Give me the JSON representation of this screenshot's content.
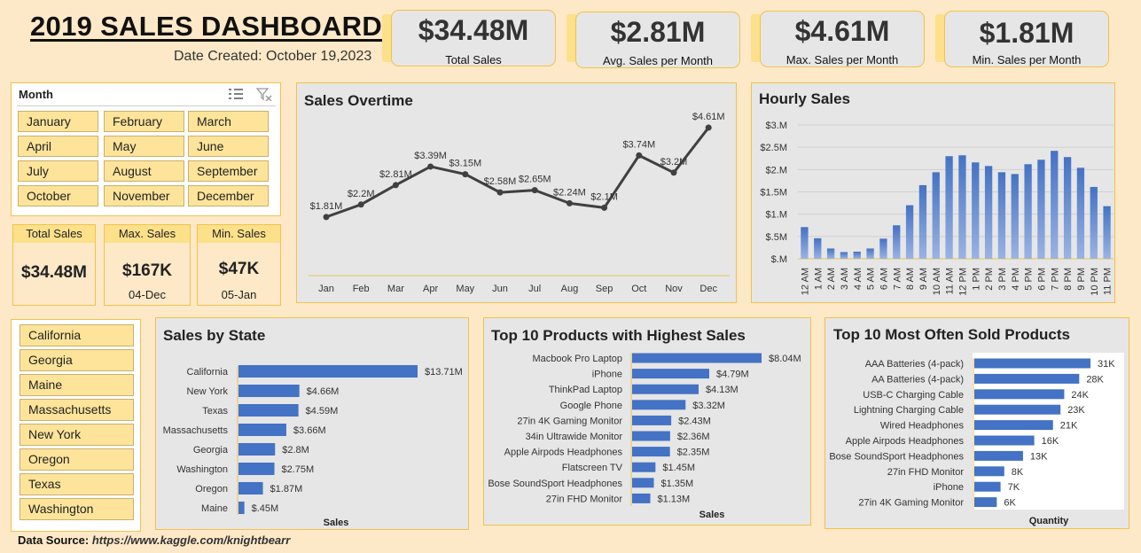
{
  "header": {
    "title": "2019 SALES DASHBOARD",
    "date_created": "Date Created: October 19,2023"
  },
  "kpis": [
    {
      "value": "$34.48M",
      "label": "Total Sales"
    },
    {
      "value": "$2.81M",
      "label": "Avg. Sales per Month"
    },
    {
      "value": "$4.61M",
      "label": "Max. Sales per Month"
    },
    {
      "value": "$1.81M",
      "label": "Min. Sales per Month"
    }
  ],
  "month_slicer": {
    "title": "Month",
    "items": [
      "January",
      "February",
      "March",
      "April",
      "May",
      "June",
      "July",
      "August",
      "September",
      "October",
      "November",
      "December"
    ]
  },
  "mini_cards": [
    {
      "label": "Total Sales",
      "value": "$34.48M",
      "sub": ""
    },
    {
      "label": "Max. Sales",
      "value": "$167K",
      "sub": "04-Dec"
    },
    {
      "label": "Min. Sales",
      "value": "$47K",
      "sub": "05-Jan"
    }
  ],
  "state_slicer": {
    "items": [
      "California",
      "Georgia",
      "Maine",
      "Massachusetts",
      "New York",
      "Oregon",
      "Texas",
      "Washington"
    ]
  },
  "colors": {
    "bar": "#4472c4",
    "line": "#404040",
    "accent": "#f2c24a",
    "slicer": "#fde49a"
  },
  "footer": {
    "label": "Data Source:",
    "url": "https://www.kaggle.com/knightbearr"
  },
  "chart_data": [
    {
      "id": "sales_overtime",
      "type": "line",
      "title": "Sales Overtime",
      "categories": [
        "Jan",
        "Feb",
        "Mar",
        "Apr",
        "May",
        "Jun",
        "Jul",
        "Aug",
        "Sep",
        "Oct",
        "Nov",
        "Dec"
      ],
      "values": [
        1.81,
        2.2,
        2.81,
        3.39,
        3.15,
        2.58,
        2.65,
        2.24,
        2.1,
        3.74,
        3.2,
        4.61
      ],
      "data_labels": [
        "$1.81M",
        "$2.2M",
        "$2.81M",
        "$3.39M",
        "$3.15M",
        "$2.58M",
        "$2.65M",
        "$2.24M",
        "$2.1M",
        "$3.74M",
        "$3.2M",
        "$4.61M"
      ],
      "ylim": [
        0,
        5
      ],
      "grid": false,
      "xlabel": "",
      "ylabel": ""
    },
    {
      "id": "hourly_sales",
      "type": "bar",
      "title": "Hourly Sales",
      "categories": [
        "12 AM",
        "1 AM",
        "2 AM",
        "3 AM",
        "4 AM",
        "5 AM",
        "6 AM",
        "7 AM",
        "8 AM",
        "9 AM",
        "10 AM",
        "11 AM",
        "12 PM",
        "1 PM",
        "2 PM",
        "3 PM",
        "4 PM",
        "5 PM",
        "6 PM",
        "7 PM",
        "8 PM",
        "9 PM",
        "10 PM",
        "11 PM"
      ],
      "values": [
        0.71,
        0.46,
        0.23,
        0.15,
        0.16,
        0.23,
        0.45,
        0.75,
        1.2,
        1.65,
        1.94,
        2.3,
        2.32,
        2.16,
        2.08,
        1.94,
        1.9,
        2.12,
        2.22,
        2.42,
        2.28,
        2.04,
        1.61,
        1.18
      ],
      "yticks": [
        "$.M",
        "$.5M",
        "$1.M",
        "$1.5M",
        "$2.M",
        "$2.5M",
        "$3.M"
      ],
      "ylim": [
        0,
        3
      ],
      "grid": true,
      "xlabel": "",
      "ylabel": ""
    },
    {
      "id": "sales_by_state",
      "type": "bar",
      "orientation": "horizontal",
      "title": "Sales by State",
      "categories": [
        "California",
        "New York",
        "Texas",
        "Massachusetts",
        "Georgia",
        "Washington",
        "Oregon",
        "Maine"
      ],
      "values": [
        13.71,
        4.66,
        4.59,
        3.66,
        2.8,
        2.75,
        1.87,
        0.45
      ],
      "data_labels": [
        "$13.71M",
        "$4.66M",
        "$4.59M",
        "$3.66M",
        "$2.8M",
        "$2.75M",
        "$1.87M",
        "$.45M"
      ],
      "xlabel": "Sales",
      "ylabel": ""
    },
    {
      "id": "top_products_sales",
      "type": "bar",
      "orientation": "horizontal",
      "title": "Top 10 Products with Highest Sales",
      "categories": [
        "Macbook Pro Laptop",
        "iPhone",
        "ThinkPad Laptop",
        "Google Phone",
        "27in 4K Gaming Monitor",
        "34in Ultrawide Monitor",
        "Apple Airpods Headphones",
        "Flatscreen TV",
        "Bose SoundSport Headphones",
        "27in FHD Monitor"
      ],
      "values": [
        8.04,
        4.79,
        4.13,
        3.32,
        2.43,
        2.36,
        2.35,
        1.45,
        1.35,
        1.13
      ],
      "data_labels": [
        "$8.04M",
        "$4.79M",
        "$4.13M",
        "$3.32M",
        "$2.43M",
        "$2.36M",
        "$2.35M",
        "$1.45M",
        "$1.35M",
        "$1.13M"
      ],
      "xlabel": "Sales",
      "ylabel": ""
    },
    {
      "id": "top_products_quantity",
      "type": "bar",
      "orientation": "horizontal",
      "title": "Top 10 Most Often Sold Products",
      "categories": [
        "AAA Batteries (4-pack)",
        "AA Batteries (4-pack)",
        "USB-C Charging Cable",
        "Lightning Charging Cable",
        "Wired Headphones",
        "Apple Airpods Headphones",
        "Bose SoundSport Headphones",
        "27in FHD Monitor",
        "iPhone",
        "27in 4K Gaming Monitor"
      ],
      "values": [
        31,
        28,
        24,
        23,
        21,
        16,
        13,
        8,
        7,
        6
      ],
      "data_labels": [
        "31K",
        "28K",
        "24K",
        "23K",
        "21K",
        "16K",
        "13K",
        "8K",
        "7K",
        "6K"
      ],
      "xlabel": "Quantity",
      "ylabel": ""
    }
  ]
}
